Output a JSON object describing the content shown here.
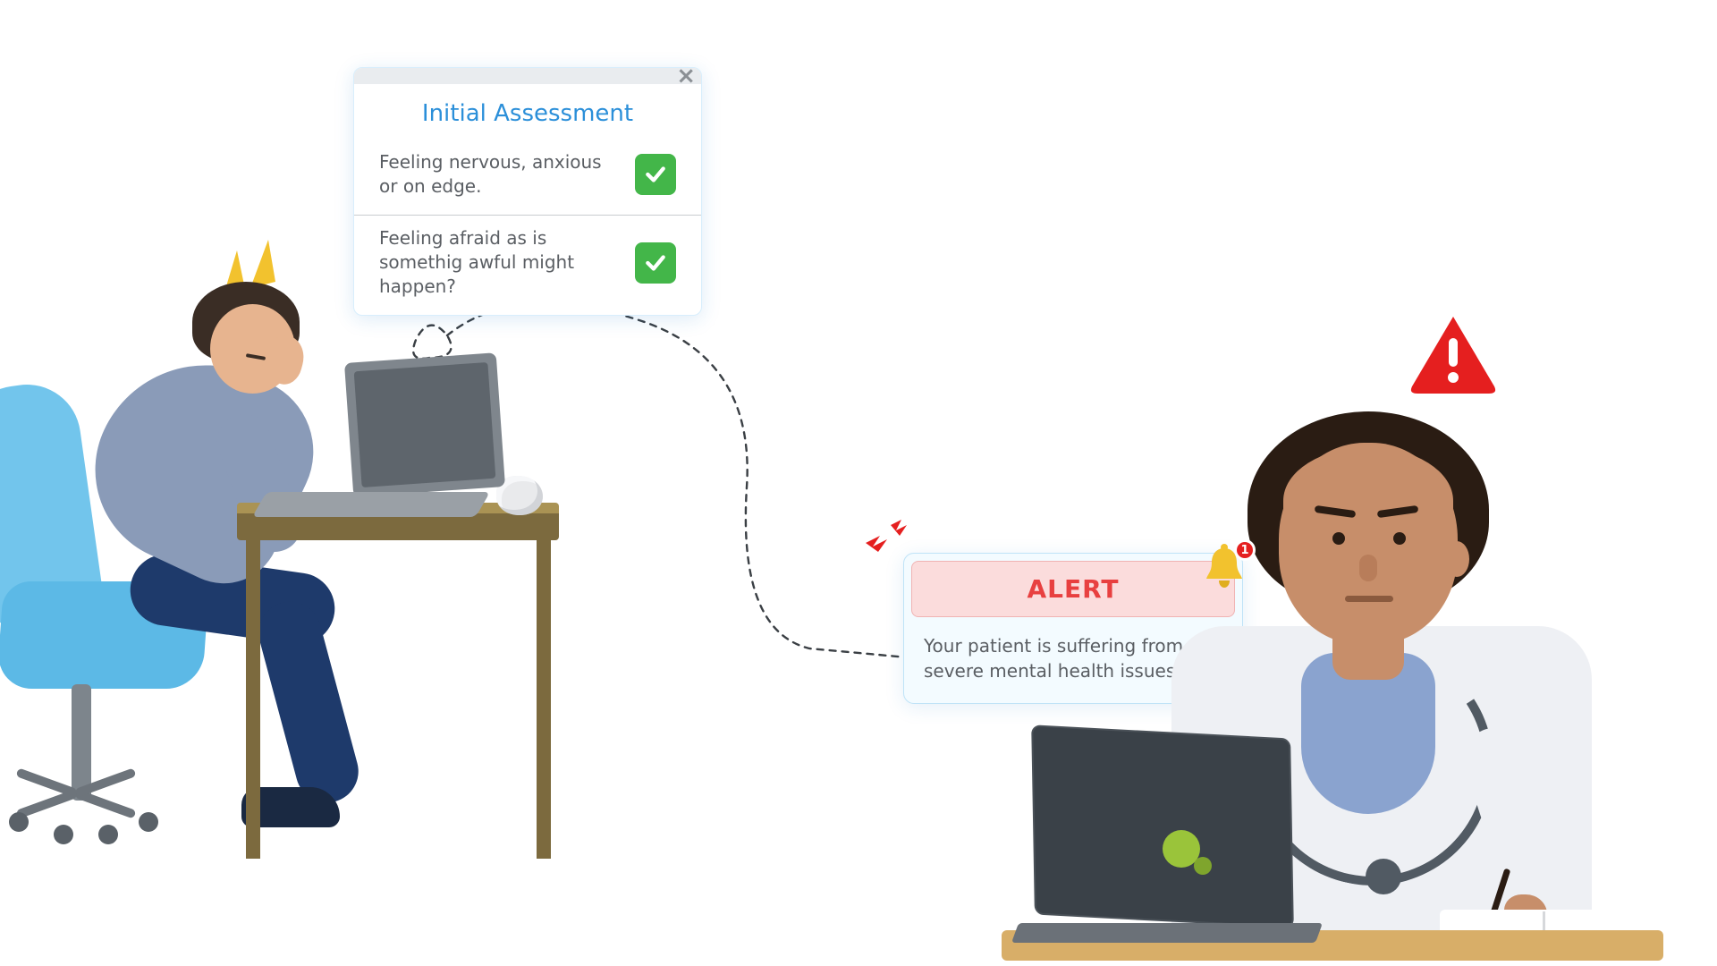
{
  "assessment": {
    "title": "Initial Assessment",
    "items": [
      {
        "text": "Feeling nervous, anxious or on edge.",
        "checked": true
      },
      {
        "text": "Feeling afraid as is somethig awful might happen?",
        "checked": true
      }
    ]
  },
  "alert": {
    "heading": "ALERT",
    "message": "Your patient is suffering from severe mental health issues.",
    "badge_count": "1"
  },
  "colors": {
    "accent_blue": "#2b8fd9",
    "check_green": "#43b649",
    "alert_red": "#e84040",
    "bell_yellow": "#f2c22e"
  }
}
